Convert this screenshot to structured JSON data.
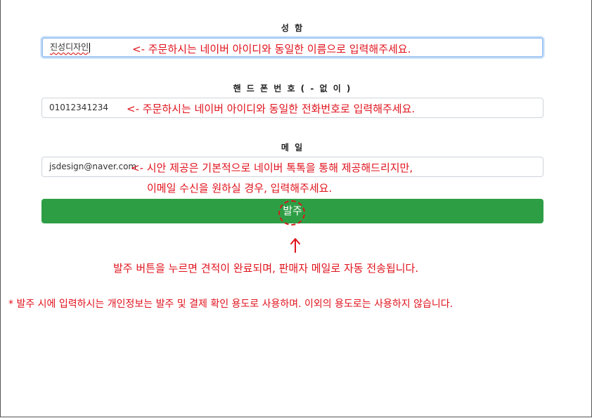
{
  "form": {
    "name": {
      "label": "성 함",
      "value": "진성디자인"
    },
    "phone": {
      "label": "핸 드 폰  번 호  ( -  없 이 )",
      "value": "01012341234"
    },
    "email": {
      "label": "메 일",
      "value": "jsdesign@naver.com"
    },
    "submit_label": "발주"
  },
  "annotations": {
    "name_note": "<- 주문하시는 네이버 아이디와 동일한 이름으로 입력해주세요.",
    "phone_note": "<- 주문하시는 네이버 아이디와 동일한 전화번호로 입력해주세요.",
    "email_note_line1": "<- 시안 제공은 기본적으로 네이버 톡톡을 통해 제공해드리지만,",
    "email_note_line2": "이메일 수신을 원하실 경우, 입력해주세요.",
    "arrow_glyph": "↑",
    "submit_note": "발주 버튼을 누르면 견적이 완료되며, 판매자 메일로 자동 전송됩니다.",
    "privacy_note": "* 발주 시에 입력하시는 개인정보는 발주 및 결제 확인 용도로 사용하며. 이외의 용도로는 사용하지 않습니다."
  },
  "colors": {
    "annotation_red": "#e0121c",
    "submit_green": "#2e9e45",
    "focus_border": "#9ec5f3"
  }
}
